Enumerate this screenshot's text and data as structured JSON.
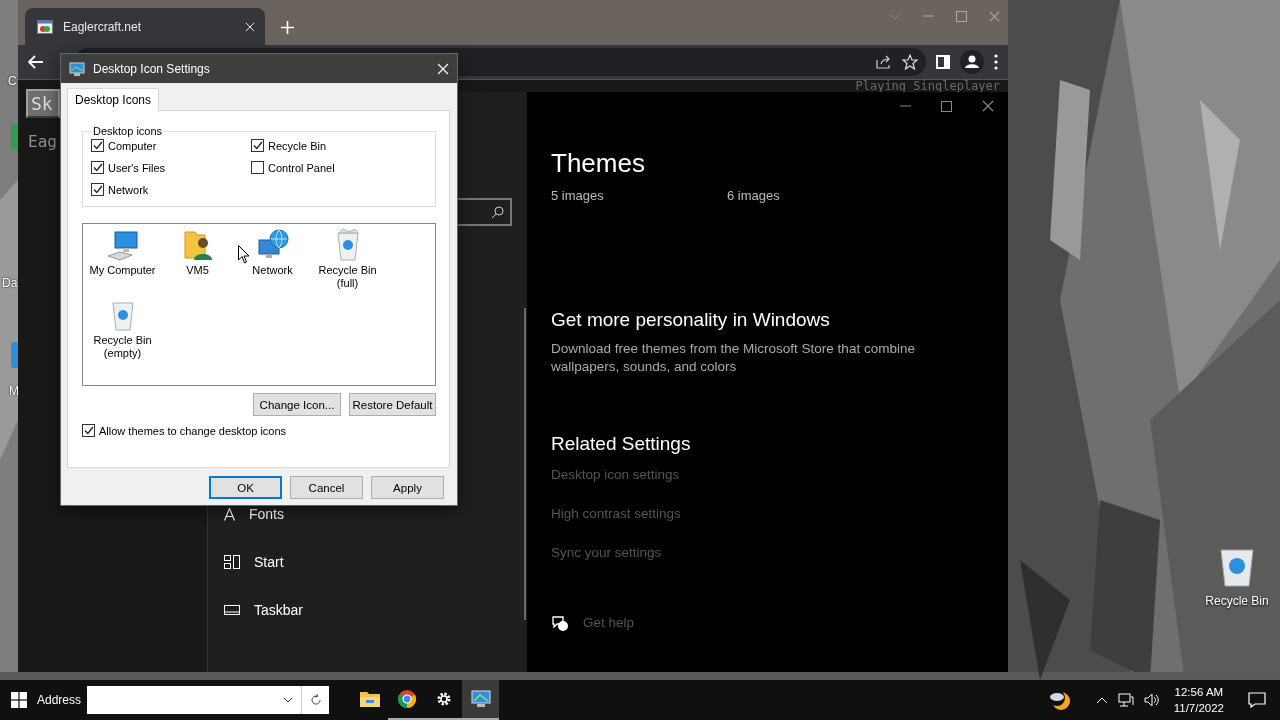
{
  "desktop": {
    "left_labels": [
      {
        "label": "C"
      },
      {
        "label": "Da"
      },
      {
        "label": "M"
      }
    ],
    "icons": [
      {
        "label": "Recycle Bin",
        "kind": "bin"
      }
    ]
  },
  "browser": {
    "tab": {
      "title": "Eaglercraft.net"
    },
    "game": {
      "status": "Playing Singleplayer",
      "button": "Sk",
      "heading": "Eag"
    }
  },
  "settings": {
    "nav": [
      {
        "label": "Fonts",
        "kind": "fonts"
      },
      {
        "label": "Start",
        "kind": "start"
      },
      {
        "label": "Taskbar",
        "kind": "taskbar"
      }
    ],
    "title": "Themes",
    "theme_counts": [
      "5 images",
      "6 images"
    ],
    "promo": {
      "heading": "Get more personality in Windows",
      "body": "Download free themes from the Microsoft Store that combine wallpapers, sounds, and colors"
    },
    "related": {
      "heading": "Related Settings",
      "links": [
        "Desktop icon settings",
        "High contrast settings",
        "Sync your settings"
      ]
    },
    "help": "Get help"
  },
  "dialog": {
    "title": "Desktop Icon Settings",
    "tabs": [
      {
        "label": "Desktop Icons",
        "selected": true
      }
    ],
    "group": "Desktop icons",
    "options": [
      {
        "label": "Computer",
        "checked": true
      },
      {
        "label": "User's Files",
        "checked": true
      },
      {
        "label": "Network",
        "checked": true
      },
      {
        "label": "Recycle Bin",
        "checked": true
      },
      {
        "label": "Control Panel",
        "checked": false
      }
    ],
    "icons": [
      {
        "label": "My Computer",
        "kind": "computer"
      },
      {
        "label": "VM5",
        "kind": "user"
      },
      {
        "label": "Network",
        "kind": "network"
      },
      {
        "label": "Recycle Bin (full)",
        "kind": "bin_full"
      },
      {
        "label": "Recycle Bin (empty)",
        "kind": "bin_empty"
      }
    ],
    "icon_buttons": [
      "Change Icon...",
      "Restore Default"
    ],
    "allow_themes": {
      "label": "Allow themes to change desktop icons",
      "checked": true
    },
    "buttons": [
      {
        "label": "OK",
        "default": true
      },
      {
        "label": "Cancel",
        "default": false
      },
      {
        "label": "Apply",
        "default": false
      }
    ]
  },
  "taskbar": {
    "address_label": "Address",
    "apps": [
      {
        "kind": "explorer",
        "open": false,
        "selected": false
      },
      {
        "kind": "chrome",
        "open": true,
        "selected": false
      },
      {
        "kind": "settings",
        "open": true,
        "selected": false
      },
      {
        "kind": "monitor",
        "open": true,
        "selected": true
      }
    ],
    "time": "12:56 AM",
    "date": "11/7/2022"
  }
}
